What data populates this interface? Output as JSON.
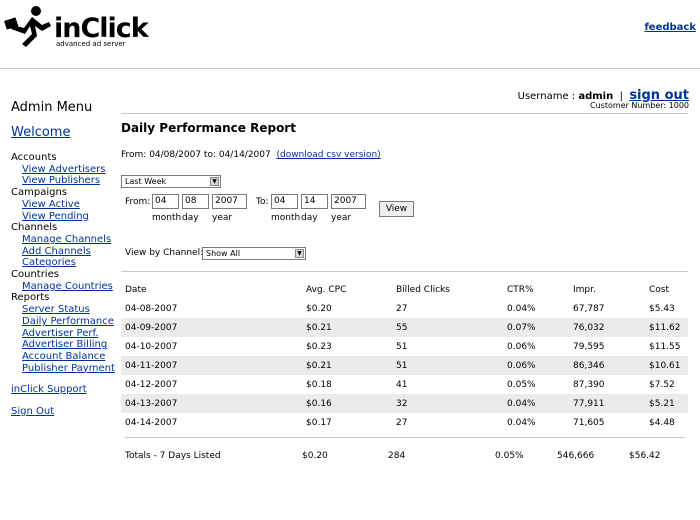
{
  "header": {
    "brand": "inClick",
    "tagline": "advanced ad server",
    "feedback": "feedback"
  },
  "sidebar": {
    "menu_title": "Admin Menu",
    "welcome": "Welcome",
    "sections": [
      {
        "label": "Accounts",
        "items": [
          "View Advertisers",
          "View Publishers"
        ]
      },
      {
        "label": "Campaigns",
        "items": [
          "View Active",
          "View Pending"
        ]
      },
      {
        "label": "Channels",
        "items": [
          "Manage Channels",
          "Add Channels",
          "Categories"
        ]
      },
      {
        "label": "Countries",
        "items": [
          "Manage Countries"
        ]
      },
      {
        "label": "Reports",
        "items": [
          "Server Status",
          "Daily Performance",
          "Advertiser Perf.",
          "Advertiser Billing",
          "Account Balance",
          "Publisher Payment"
        ]
      }
    ],
    "support": "inClick Support",
    "sign_out": "Sign Out"
  },
  "user": {
    "username_label": "Username :",
    "username": "admin",
    "separator": "|",
    "sign_out": "sign out",
    "customer_number_label": "Customer Number:",
    "customer_number": "1000"
  },
  "report": {
    "title": "Daily Performance Report",
    "range_text": "From: 04/08/2007 to: 04/14/2007",
    "download_link": "(download csv version)",
    "period_select": "Last Week",
    "from_label": "From:",
    "to_label": "To:",
    "from": {
      "month": "04",
      "day": "08",
      "year": "2007"
    },
    "to": {
      "month": "04",
      "day": "14",
      "year": "2007"
    },
    "month_label": "month",
    "day_label": "day",
    "year_label": "year",
    "view_button": "View",
    "channel_label": "View by Channel:",
    "channel_select": "Show All"
  },
  "table": {
    "columns": [
      "Date",
      "Avg. CPC",
      "Billed Clicks",
      "CTR%",
      "Impr.",
      "Cost"
    ],
    "rows": [
      [
        "04-08-2007",
        "$0.20",
        "27",
        "0.04%",
        "67,787",
        "$5.43"
      ],
      [
        "04-09-2007",
        "$0.21",
        "55",
        "0.07%",
        "76,032",
        "$11.62"
      ],
      [
        "04-10-2007",
        "$0.23",
        "51",
        "0.06%",
        "79,595",
        "$11.55"
      ],
      [
        "04-11-2007",
        "$0.21",
        "51",
        "0.06%",
        "86,346",
        "$10.61"
      ],
      [
        "04-12-2007",
        "$0.18",
        "41",
        "0.05%",
        "87,390",
        "$7.52"
      ],
      [
        "04-13-2007",
        "$0.16",
        "32",
        "0.04%",
        "77,911",
        "$5.21"
      ],
      [
        "04-14-2007",
        "$0.17",
        "27",
        "0.04%",
        "71,605",
        "$4.48"
      ]
    ],
    "totals": [
      "Totals - 7 Days Listed",
      "$0.20",
      "284",
      "0.05%",
      "546,666",
      "$56.42"
    ]
  }
}
